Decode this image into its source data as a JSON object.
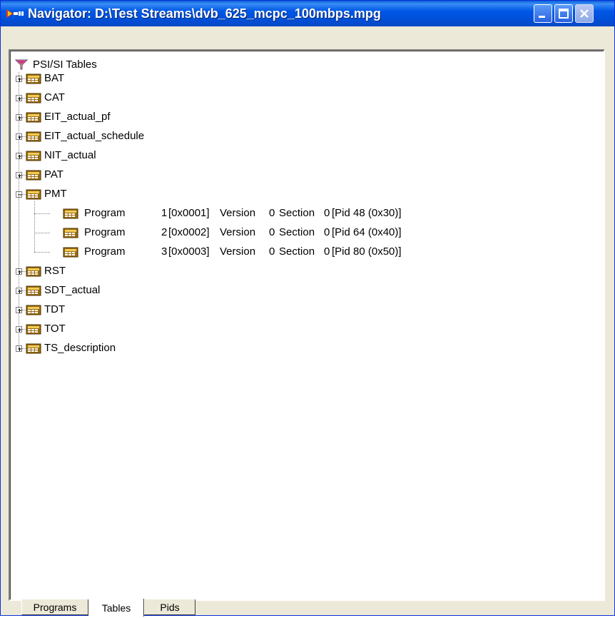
{
  "window": {
    "title": "Navigator: D:\\Test Streams\\dvb_625_mcpc_100mbps.mpg"
  },
  "tree": {
    "root_label": "PSI/SI Tables",
    "tables": [
      {
        "label": "BAT",
        "expanded": false
      },
      {
        "label": "CAT",
        "expanded": false
      },
      {
        "label": "EIT_actual_pf",
        "expanded": false
      },
      {
        "label": "EIT_actual_schedule",
        "expanded": false
      },
      {
        "label": "NIT_actual",
        "expanded": false
      },
      {
        "label": "PAT",
        "expanded": false
      },
      {
        "label": "PMT",
        "expanded": true,
        "children": [
          {
            "program": "Program",
            "num": "1",
            "hex": "[0x0001]",
            "version": "Version",
            "version_num": "0",
            "section": "Section",
            "section_num": "0",
            "pid": "[Pid 48 (0x30)]"
          },
          {
            "program": "Program",
            "num": "2",
            "hex": "[0x0002]",
            "version": "Version",
            "version_num": "0",
            "section": "Section",
            "section_num": "0",
            "pid": "[Pid 64 (0x40)]"
          },
          {
            "program": "Program",
            "num": "3",
            "hex": "[0x0003]",
            "version": "Version",
            "version_num": "0",
            "section": "Section",
            "section_num": "0",
            "pid": "[Pid 80 (0x50)]"
          }
        ]
      },
      {
        "label": "RST",
        "expanded": false
      },
      {
        "label": "SDT_actual",
        "expanded": false
      },
      {
        "label": "TDT",
        "expanded": false
      },
      {
        "label": "TOT",
        "expanded": false
      },
      {
        "label": "TS_description",
        "expanded": false
      }
    ]
  },
  "tabs": [
    {
      "label": "Programs",
      "active": false
    },
    {
      "label": "Tables",
      "active": true
    },
    {
      "label": "Pids",
      "active": false
    }
  ]
}
